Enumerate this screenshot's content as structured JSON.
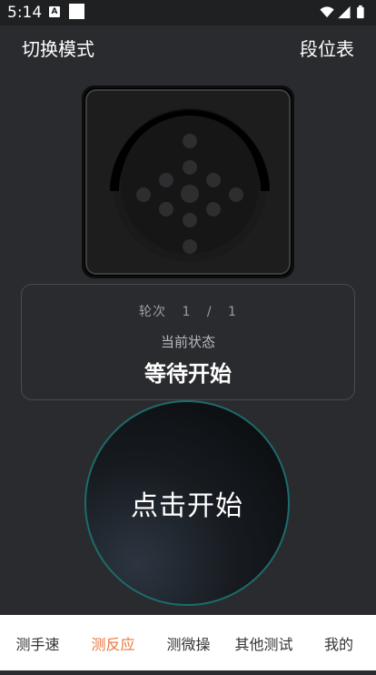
{
  "status_bar": {
    "time": "5:14",
    "notification_icon_letter": "A",
    "icons": [
      "wifi-icon",
      "signal-icon",
      "battery-icon"
    ]
  },
  "header": {
    "left_label": "切换模式",
    "right_label": "段位表"
  },
  "panel": {
    "round_label": "轮次",
    "round_current": "1",
    "round_separator": "/",
    "round_total": "1",
    "status_label": "当前状态",
    "status_value": "等待开始"
  },
  "start_button": {
    "label": "点击开始"
  },
  "nav": {
    "items": [
      {
        "label": "测手速"
      },
      {
        "label": "测反应"
      },
      {
        "label": "测微操"
      },
      {
        "label": "其他测试"
      },
      {
        "label": "我的"
      }
    ],
    "active_index": 1
  },
  "colors": {
    "background": "#2a2b2e",
    "accent": "#e8763e",
    "button_ring": "#1d6b6b"
  }
}
